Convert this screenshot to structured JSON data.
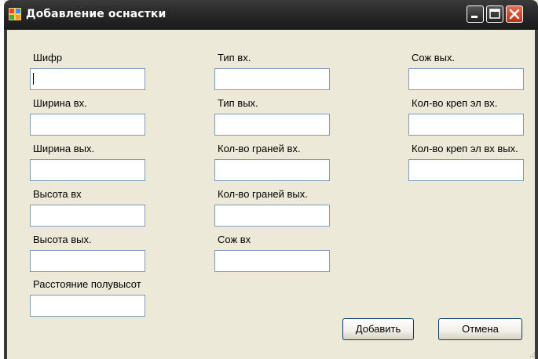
{
  "window": {
    "title": "Добавление оснастки",
    "controls": [
      "minimize-icon",
      "maximize-icon",
      "close-icon"
    ]
  },
  "columns": [
    {
      "fields": [
        {
          "label": "Шифр",
          "value": "",
          "focused": true
        },
        {
          "label": "Ширина вх.",
          "value": ""
        },
        {
          "label": "Ширина вых.",
          "value": ""
        },
        {
          "label": "Высота вх",
          "value": ""
        },
        {
          "label": "Высота вых.",
          "value": ""
        },
        {
          "label": "Расстояние полувысот",
          "value": ""
        }
      ]
    },
    {
      "fields": [
        {
          "label": "Тип вх.",
          "value": ""
        },
        {
          "label": "Тип вых.",
          "value": ""
        },
        {
          "label": "Кол-во граней вх.",
          "value": ""
        },
        {
          "label": "Кол-во граней вых.",
          "value": ""
        },
        {
          "label": "Сож вх",
          "value": ""
        }
      ]
    },
    {
      "fields": [
        {
          "label": "Сож вых.",
          "value": ""
        },
        {
          "label": "Кол-во креп эл вх.",
          "value": ""
        },
        {
          "label": "Кол-во креп эл вх вых.",
          "value": ""
        }
      ]
    }
  ],
  "buttons": {
    "add": "Добавить",
    "cancel": "Отмена"
  }
}
